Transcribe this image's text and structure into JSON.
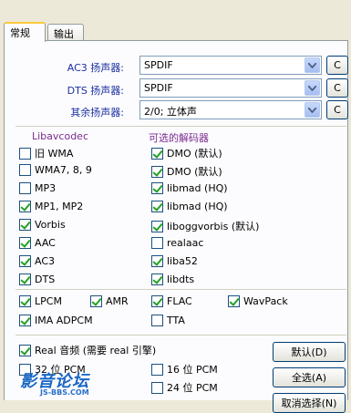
{
  "tabs": [
    {
      "label": "常规",
      "active": true
    },
    {
      "label": "输出",
      "active": false
    }
  ],
  "speakers": [
    {
      "label": "AC3 扬声器:",
      "value": "SPDIF",
      "button": "C"
    },
    {
      "label": "DTS 扬声器:",
      "value": "SPDIF",
      "button": "C"
    },
    {
      "label": "其余扬声器:",
      "value": "2/0; 立体声",
      "button": "C"
    }
  ],
  "columns": {
    "left_header": "Libavcodec",
    "right_header": "可选的解码器"
  },
  "left_items": [
    {
      "label": "旧 WMA",
      "checked": false
    },
    {
      "label": "WMA7, 8, 9",
      "checked": false
    },
    {
      "label": "MP3",
      "checked": false
    },
    {
      "label": "MP1, MP2",
      "checked": true
    },
    {
      "label": "Vorbis",
      "checked": true
    },
    {
      "label": "AAC",
      "checked": true
    },
    {
      "label": "AC3",
      "checked": true
    },
    {
      "label": "DTS",
      "checked": true
    }
  ],
  "right_items": [
    {
      "label": "DMO (默认)",
      "checked": true
    },
    {
      "label": "DMO (默认)",
      "checked": true
    },
    {
      "label": "libmad (HQ)",
      "checked": true
    },
    {
      "label": "libmad (HQ)",
      "checked": true
    },
    {
      "label": "liboggvorbis (默认)",
      "checked": true
    },
    {
      "label": "realaac",
      "checked": false
    },
    {
      "label": "liba52",
      "checked": true
    },
    {
      "label": "libdts",
      "checked": true
    }
  ],
  "lossless": [
    {
      "label": "LPCM",
      "checked": true
    },
    {
      "label": "AMR",
      "checked": true
    },
    {
      "label": "FLAC",
      "checked": true
    },
    {
      "label": "WavPack",
      "checked": true
    },
    {
      "label": "IMA ADPCM",
      "checked": true
    },
    {
      "label": "TTA",
      "checked": false
    }
  ],
  "real": {
    "label": "Real 音频 (需要 real 引擎)",
    "checked": true
  },
  "pcm": [
    {
      "label": "32 位 PCM",
      "checked": false
    },
    {
      "label": "16 位 PCM",
      "checked": false
    },
    {
      "label": "24 位 PCM",
      "checked": false
    }
  ],
  "buttons": {
    "default": "默认(D)",
    "select_all": "全选(A)",
    "cancel_all": "取消选择(N)"
  },
  "watermark": {
    "title": "影音论坛",
    "sub": "JS-BBS.COM"
  }
}
